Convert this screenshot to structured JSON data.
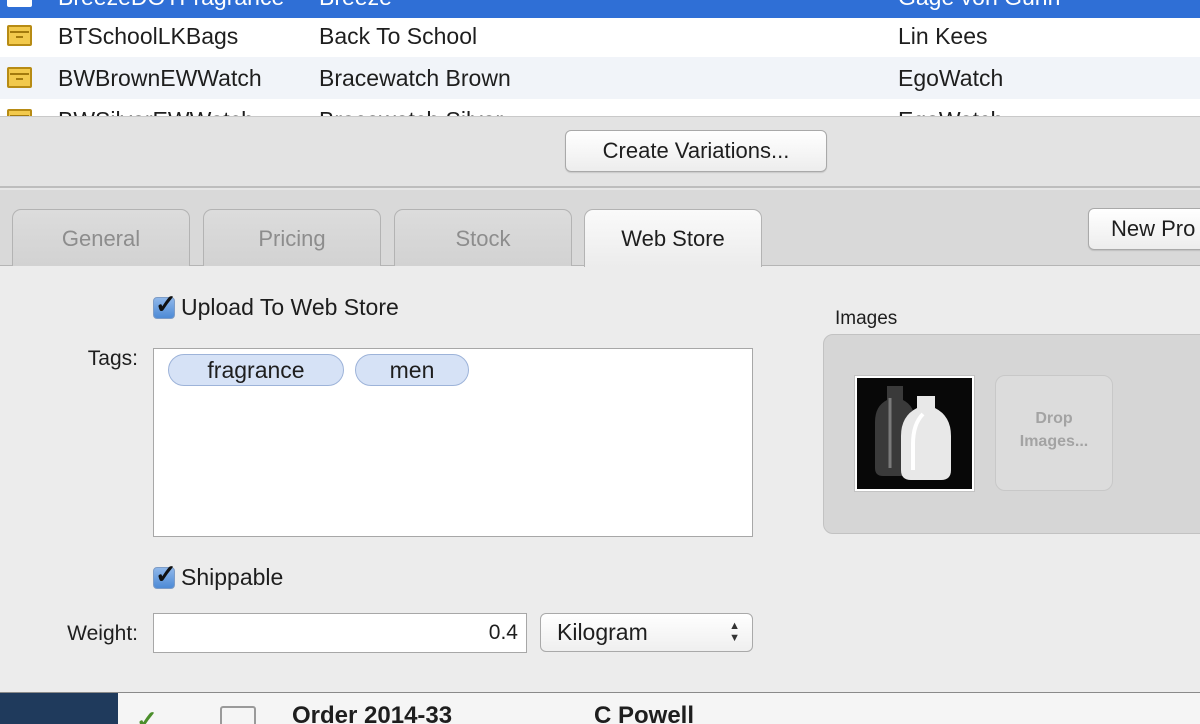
{
  "product_list": {
    "rows": [
      {
        "sku": "BreezeDOTFragrance",
        "name": "Breeze",
        "brand": "Gage von Gunn",
        "selected": true
      },
      {
        "sku": "BTSchoolLKBags",
        "name": "Back To School",
        "brand": "Lin Kees",
        "selected": false
      },
      {
        "sku": "BWBrownEWWatch",
        "name": "Bracewatch Brown",
        "brand": "EgoWatch",
        "selected": false
      },
      {
        "sku": "BWSilverEWWatch",
        "name": "Bracewatch Silver",
        "brand": "EgoWatch",
        "selected": false
      }
    ],
    "row_icon": "archive-box-icon",
    "selection_color": "#2f6fd6"
  },
  "variations": {
    "create_label": "Create Variations..."
  },
  "tabs": [
    {
      "label": "General",
      "active": false
    },
    {
      "label": "Pricing",
      "active": false
    },
    {
      "label": "Stock",
      "active": false
    },
    {
      "label": "Web Store",
      "active": true
    }
  ],
  "new_product_label": "New Pro",
  "web_store": {
    "upload_label": "Upload To Web Store",
    "upload_checked": true,
    "tags_label": "Tags:",
    "tags": [
      "fragrance",
      "men"
    ],
    "shippable_label": "Shippable",
    "shippable_checked": true,
    "weight_label": "Weight:",
    "weight_value": "0.4",
    "weight_unit": "Kilogram",
    "images_label": "Images",
    "drop_line1": "Drop",
    "drop_line2": "Images..."
  },
  "background_window": {
    "order_label": "Order 2014-33",
    "customer": "C Powell",
    "status_icon": "checkmark-icon",
    "doc_icon": "document-icon"
  }
}
